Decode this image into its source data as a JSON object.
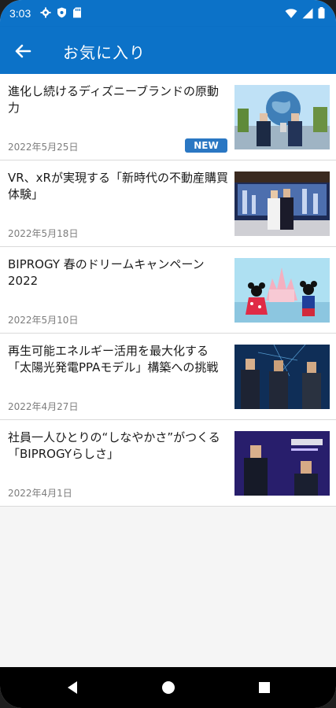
{
  "status_bar": {
    "time": "3:03",
    "left_icons": [
      "gear-icon",
      "shield-icon",
      "sd-card-icon"
    ],
    "right_icons": [
      "wifi-icon",
      "signal-icon",
      "battery-icon"
    ]
  },
  "app_bar": {
    "title": "お気に入り",
    "back_icon": "back-arrow-icon",
    "color": "#0c72c8"
  },
  "favorites": [
    {
      "title": "進化し続けるディズニーブランドの原動力",
      "date": "2022年5月25日",
      "badge": "NEW"
    },
    {
      "title": "VR、xRが実現する「新時代の不動産購買体験」",
      "date": "2022年5月18日",
      "badge": ""
    },
    {
      "title": "BIPROGY 春のドリームキャンペーン2022",
      "date": "2022年5月10日",
      "badge": ""
    },
    {
      "title": "再生可能エネルギー活用を最大化する「太陽光発電PPAモデル」構築への挑戦",
      "date": "2022年4月27日",
      "badge": ""
    },
    {
      "title": "社員一人ひとりの“しなやかさ”がつくる「BIPROGYらしさ」",
      "date": "2022年4月1日",
      "badge": ""
    }
  ],
  "nav_bar": {
    "buttons": [
      "back-triangle-icon",
      "home-circle-icon",
      "recents-square-icon"
    ]
  }
}
